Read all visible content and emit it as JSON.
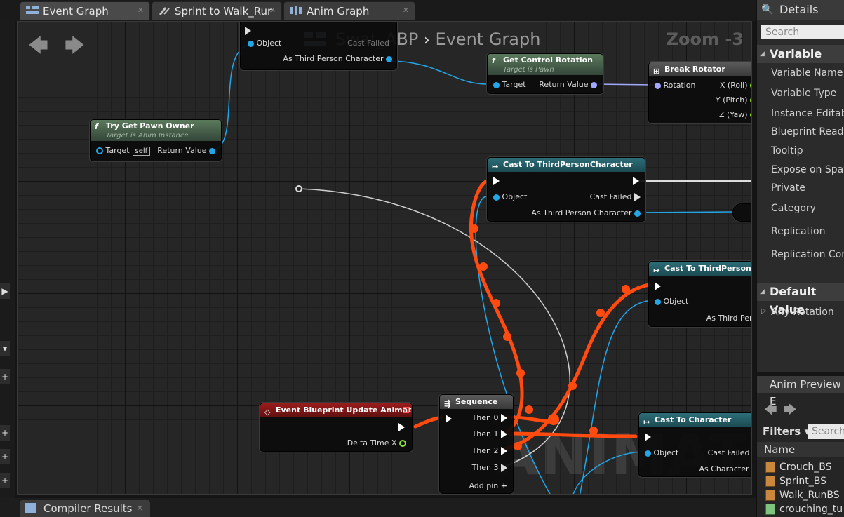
{
  "tabs": [
    {
      "label": "Event Graph",
      "icon": "event-graph-icon"
    },
    {
      "label": "Sprint to Walk_Rur",
      "icon": "transition-icon"
    },
    {
      "label": "Anim Graph",
      "icon": "anim-graph-icon"
    }
  ],
  "graph": {
    "breadcrumb_asset": "Swat_ABP",
    "breadcrumb_sep": "›",
    "breadcrumb_page": "Event Graph",
    "zoom": "Zoom -3",
    "watermark": "ANIMATION"
  },
  "nodes": {
    "cast_top": {
      "pin_object": "Object",
      "pin_cast_failed": "Cast Failed",
      "pin_as": "As Third Person Character"
    },
    "get_control_rotation": {
      "title": "Get Control Rotation",
      "subtitle": "Target is Pawn",
      "pin_target": "Target",
      "pin_return": "Return Value"
    },
    "break_rotator": {
      "title": "Break Rotator",
      "pin_rotation": "Rotation",
      "pin_x": "X (Roll)",
      "pin_y": "Y (Pitch)",
      "pin_z": "Z (Yaw)"
    },
    "try_get_pawn_owner": {
      "title": "Try Get Pawn Owner",
      "subtitle": "Target is Anim Instance",
      "pin_target": "Target",
      "self": "self",
      "pin_return": "Return Value"
    },
    "cast_mid": {
      "title": "Cast To ThirdPersonCharacter",
      "pin_object": "Object",
      "pin_cast_failed": "Cast Failed",
      "pin_as": "As Third Person Character"
    },
    "cast_right": {
      "title": "Cast To ThirdPersonChar",
      "pin_object": "Object",
      "pin_as": "As Third Perso"
    },
    "event_update": {
      "title": "Event Blueprint Update Animation",
      "pin_delta": "Delta Time X"
    },
    "sequence": {
      "title": "Sequence",
      "then0": "Then 0",
      "then1": "Then 1",
      "then2": "Then 2",
      "then3": "Then 3",
      "add_pin": "Add pin"
    },
    "cast_character": {
      "title": "Cast To Character",
      "pin_object": "Object",
      "pin_cast_failed": "Cast Failed",
      "pin_as": "As Character"
    }
  },
  "details": {
    "title": "Details",
    "search_placeholder": "Search",
    "section_variable": "Variable",
    "props": [
      "Variable Name",
      "Variable Type",
      "Instance Editab",
      "Blueprint Read (",
      "Tooltip",
      "Expose on Spaw",
      "Private",
      "Category",
      "Replication",
      "Replication Con"
    ],
    "section_default": "Default Value",
    "any_rotation": "Any Rotation"
  },
  "anim_preview": {
    "title": "Anim Preview E",
    "filters": "Filters",
    "search_placeholder": "Search",
    "column_name": "Name",
    "assets": [
      {
        "name": "Crouch_BS",
        "icon": "blendspace-icon"
      },
      {
        "name": "Sprint_BS",
        "icon": "blendspace-icon"
      },
      {
        "name": "Walk_RunBS",
        "icon": "blendspace-icon"
      },
      {
        "name": "crouching_tu",
        "icon": "animation-sequence-icon"
      }
    ]
  },
  "bottom": {
    "compiler_results": "Compiler Results"
  },
  "colors": {
    "exec_wire": "#ff4a10",
    "object_wire": "#22a6e8",
    "rotator_wire": "#a0a8ff",
    "event_header": "#9a1c1c",
    "cast_header": "#2d6e78",
    "function_header": "#4e6b4e"
  }
}
